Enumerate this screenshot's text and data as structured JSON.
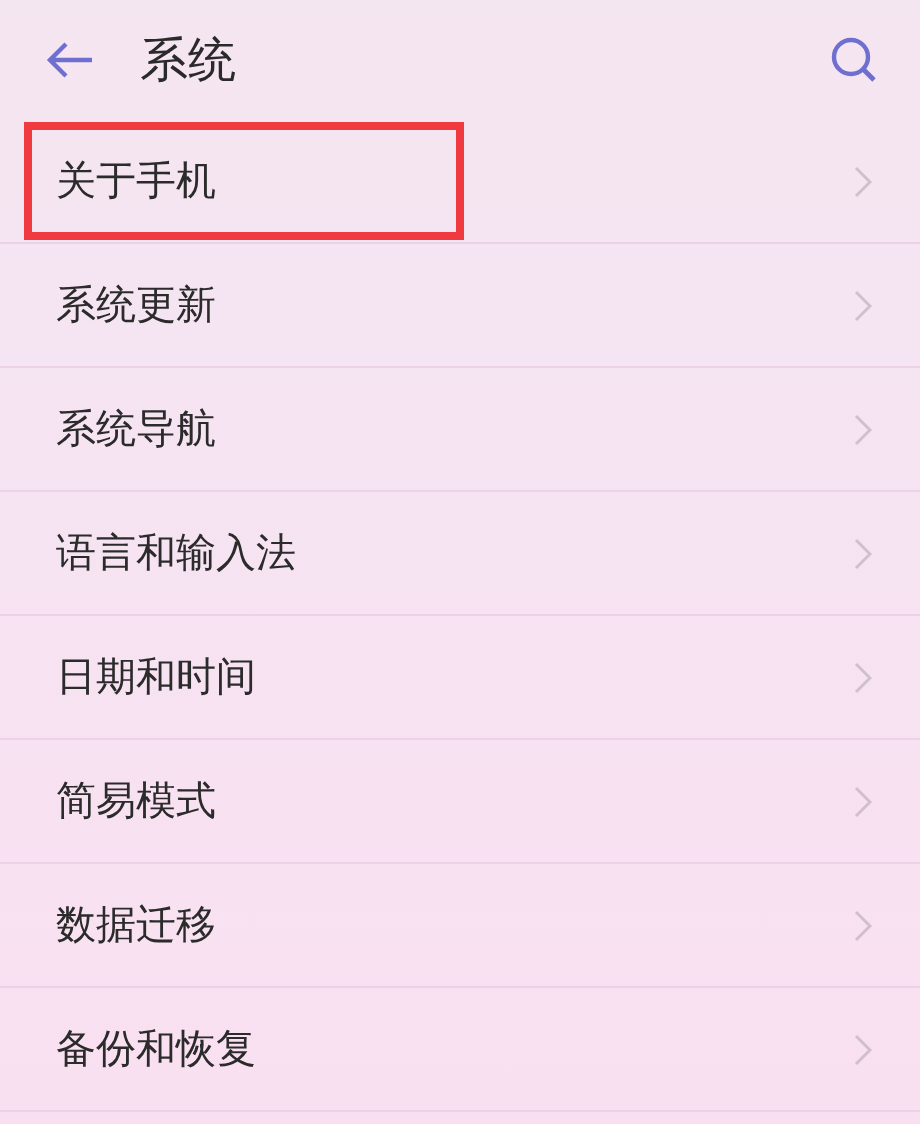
{
  "header": {
    "title": "系统"
  },
  "items": [
    {
      "label": "关于手机",
      "highlighted": true
    },
    {
      "label": "系统更新",
      "highlighted": false
    },
    {
      "label": "系统导航",
      "highlighted": false
    },
    {
      "label": "语言和输入法",
      "highlighted": false
    },
    {
      "label": "日期和时间",
      "highlighted": false
    },
    {
      "label": "简易模式",
      "highlighted": false
    },
    {
      "label": "数据迁移",
      "highlighted": false
    },
    {
      "label": "备份和恢复",
      "highlighted": false
    }
  ]
}
